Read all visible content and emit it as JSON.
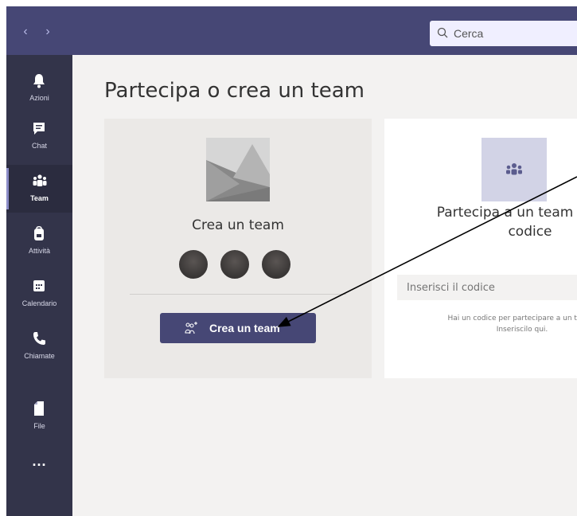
{
  "header": {
    "search_placeholder": "Cerca",
    "back_icon": "chevron-left-icon",
    "forward_icon": "chevron-right-icon"
  },
  "rail": {
    "items": [
      {
        "label": "Azioni",
        "icon": "bell-icon"
      },
      {
        "label": "Chat",
        "icon": "chat-icon"
      },
      {
        "label": "Team",
        "icon": "teams-icon",
        "active": true
      },
      {
        "label": "Attività",
        "icon": "backpack-icon"
      },
      {
        "label": "Calendario",
        "icon": "calendar-icon"
      },
      {
        "label": "Chiamate",
        "icon": "phone-icon"
      },
      {
        "label": "File",
        "icon": "file-icon"
      }
    ],
    "more": "..."
  },
  "main": {
    "title": "Partecipa o crea un team",
    "create_card": {
      "title": "Crea un team",
      "button_label": "Crea un team"
    },
    "join_card": {
      "title_line1": "Partecipa a un team con un",
      "title_line2": "codice",
      "input_placeholder": "Inserisci il codice",
      "hint_line1": "Hai un codice per partecipare a un team?",
      "hint_line2": "Inseriscilo qui."
    }
  },
  "colors": {
    "brand": "#464775",
    "rail": "#33344a",
    "background": "#f3f2f1",
    "annotation_arrow": "#000000"
  }
}
